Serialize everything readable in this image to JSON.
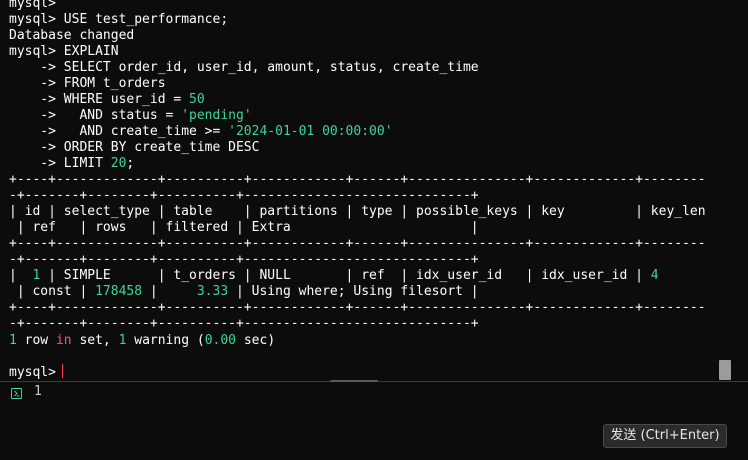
{
  "terminal": {
    "prompt": "mysql>",
    "cont": "    ->",
    "l0": "mysql>",
    "l1_cmd": " USE test_performance;",
    "l2": "Database changed",
    "l3_cmd": " EXPLAIN",
    "l4_text": " SELECT order_id, user_id, amount, status, create_time",
    "l5_text": " FROM t_orders",
    "l6_text": " WHERE user_id = ",
    "l6_num": "50",
    "l7_text": "   AND status = ",
    "l7_str": "'pending'",
    "l8_text": "   AND create_time >= ",
    "l8_str": "'2024-01-01 00:00:00'",
    "l9_text": " ORDER BY create_time DESC",
    "l10_text": " LIMIT ",
    "l10_num": "20",
    "l10_end": ";",
    "sep1": "+----+-------------+----------+------------+------+---------------+-------------+--------",
    "sep2": "-+-------+--------+----------+-----------------------------+",
    "hdr1": "| id | select_type | table    | partitions | type | possible_keys | key         | key_len",
    "hdr2": " | ref   | rows   | filtered | Extra                       |",
    "row1_a": "|  ",
    "row1_id": "1",
    "row1_b": " | SIMPLE      | t_orders | NULL       | ref  | idx_user_id   | idx_user_id | ",
    "row1_keylen": "4",
    "row2_a": " | const | ",
    "row2_rows": "178458",
    "row2_b": " |     ",
    "row2_filtered": "3.33",
    "row2_c": " | Using where; Using filesort |",
    "summary_n": "1",
    "summary_row": " row ",
    "summary_in": "in",
    "summary_set": " set, ",
    "summary_w": "1",
    "summary_warning": " warning (",
    "summary_sec": "0.00",
    "summary_end": " sec)",
    "final_prompt": "mysql>"
  },
  "input": {
    "line_number": "1",
    "send_label": "发送 (Ctrl+Enter)"
  },
  "colors": {
    "background": "#0c0c0c",
    "text": "#cccccc",
    "number": "#3fd49b",
    "keyword_in": "#ff4f7a",
    "cursor": "#ff3b3b"
  }
}
